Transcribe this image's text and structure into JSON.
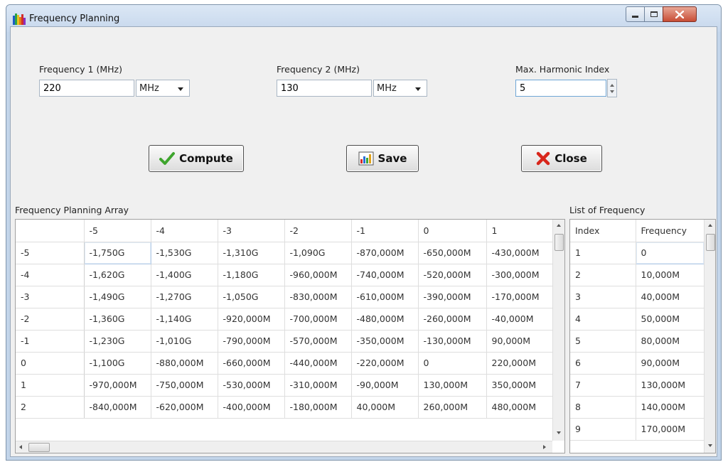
{
  "window": {
    "title": "Frequency Planning",
    "icon": "spectrum-app-icon",
    "controls": [
      "minimize-icon",
      "maximize-icon",
      "close-icon"
    ]
  },
  "inputs": {
    "freq1": {
      "label": "Frequency 1 (MHz)",
      "value": "220",
      "unit": "MHz"
    },
    "freq2": {
      "label": "Frequency 2 (MHz)",
      "value": "130",
      "unit": "MHz"
    },
    "harmonic": {
      "label": "Max. Harmonic Index",
      "value": "5"
    }
  },
  "buttons": {
    "compute": {
      "label": "Compute",
      "icon": "checkmark-icon",
      "icon_color": "#3fa52e"
    },
    "save": {
      "label": "Save",
      "icon": "save-chart-icon"
    },
    "close": {
      "label": "Close",
      "icon": "red-x-icon",
      "icon_color": "#d8261b"
    }
  },
  "planning_array": {
    "title": "Frequency Planning Array",
    "columns": [
      "",
      "-5",
      "-4",
      "-3",
      "-2",
      "-1",
      "0",
      "1"
    ],
    "rows": [
      {
        "header": "-5",
        "cells": [
          "-1,750G",
          "-1,530G",
          "-1,310G",
          "-1,090G",
          "-870,000M",
          "-650,000M",
          "-430,000M"
        ]
      },
      {
        "header": "-4",
        "cells": [
          "-1,620G",
          "-1,400G",
          "-1,180G",
          "-960,000M",
          "-740,000M",
          "-520,000M",
          "-300,000M"
        ]
      },
      {
        "header": "-3",
        "cells": [
          "-1,490G",
          "-1,270G",
          "-1,050G",
          "-830,000M",
          "-610,000M",
          "-390,000M",
          "-170,000M"
        ]
      },
      {
        "header": "-2",
        "cells": [
          "-1,360G",
          "-1,140G",
          "-920,000M",
          "-700,000M",
          "-480,000M",
          "-260,000M",
          "-40,000M"
        ]
      },
      {
        "header": "-1",
        "cells": [
          "-1,230G",
          "-1,010G",
          "-790,000M",
          "-570,000M",
          "-350,000M",
          "-130,000M",
          "90,000M"
        ]
      },
      {
        "header": "0",
        "cells": [
          "-1,100G",
          "-880,000M",
          "-660,000M",
          "-440,000M",
          "-220,000M",
          "0",
          "220,000M"
        ]
      },
      {
        "header": "1",
        "cells": [
          "-970,000M",
          "-750,000M",
          "-530,000M",
          "-310,000M",
          "-90,000M",
          "130,000M",
          "350,000M"
        ]
      },
      {
        "header": "2",
        "cells": [
          "-840,000M",
          "-620,000M",
          "-400,000M",
          "-180,000M",
          "40,000M",
          "260,000M",
          "480,000M"
        ]
      }
    ]
  },
  "frequency_list": {
    "title": "List of Frequency",
    "columns": [
      "Index",
      "Frequency"
    ],
    "rows": [
      [
        "1",
        "0"
      ],
      [
        "2",
        "10,000M"
      ],
      [
        "3",
        "40,000M"
      ],
      [
        "4",
        "50,000M"
      ],
      [
        "5",
        "80,000M"
      ],
      [
        "6",
        "90,000M"
      ],
      [
        "7",
        "130,000M"
      ],
      [
        "8",
        "140,000M"
      ],
      [
        "9",
        "170,000M"
      ]
    ]
  }
}
